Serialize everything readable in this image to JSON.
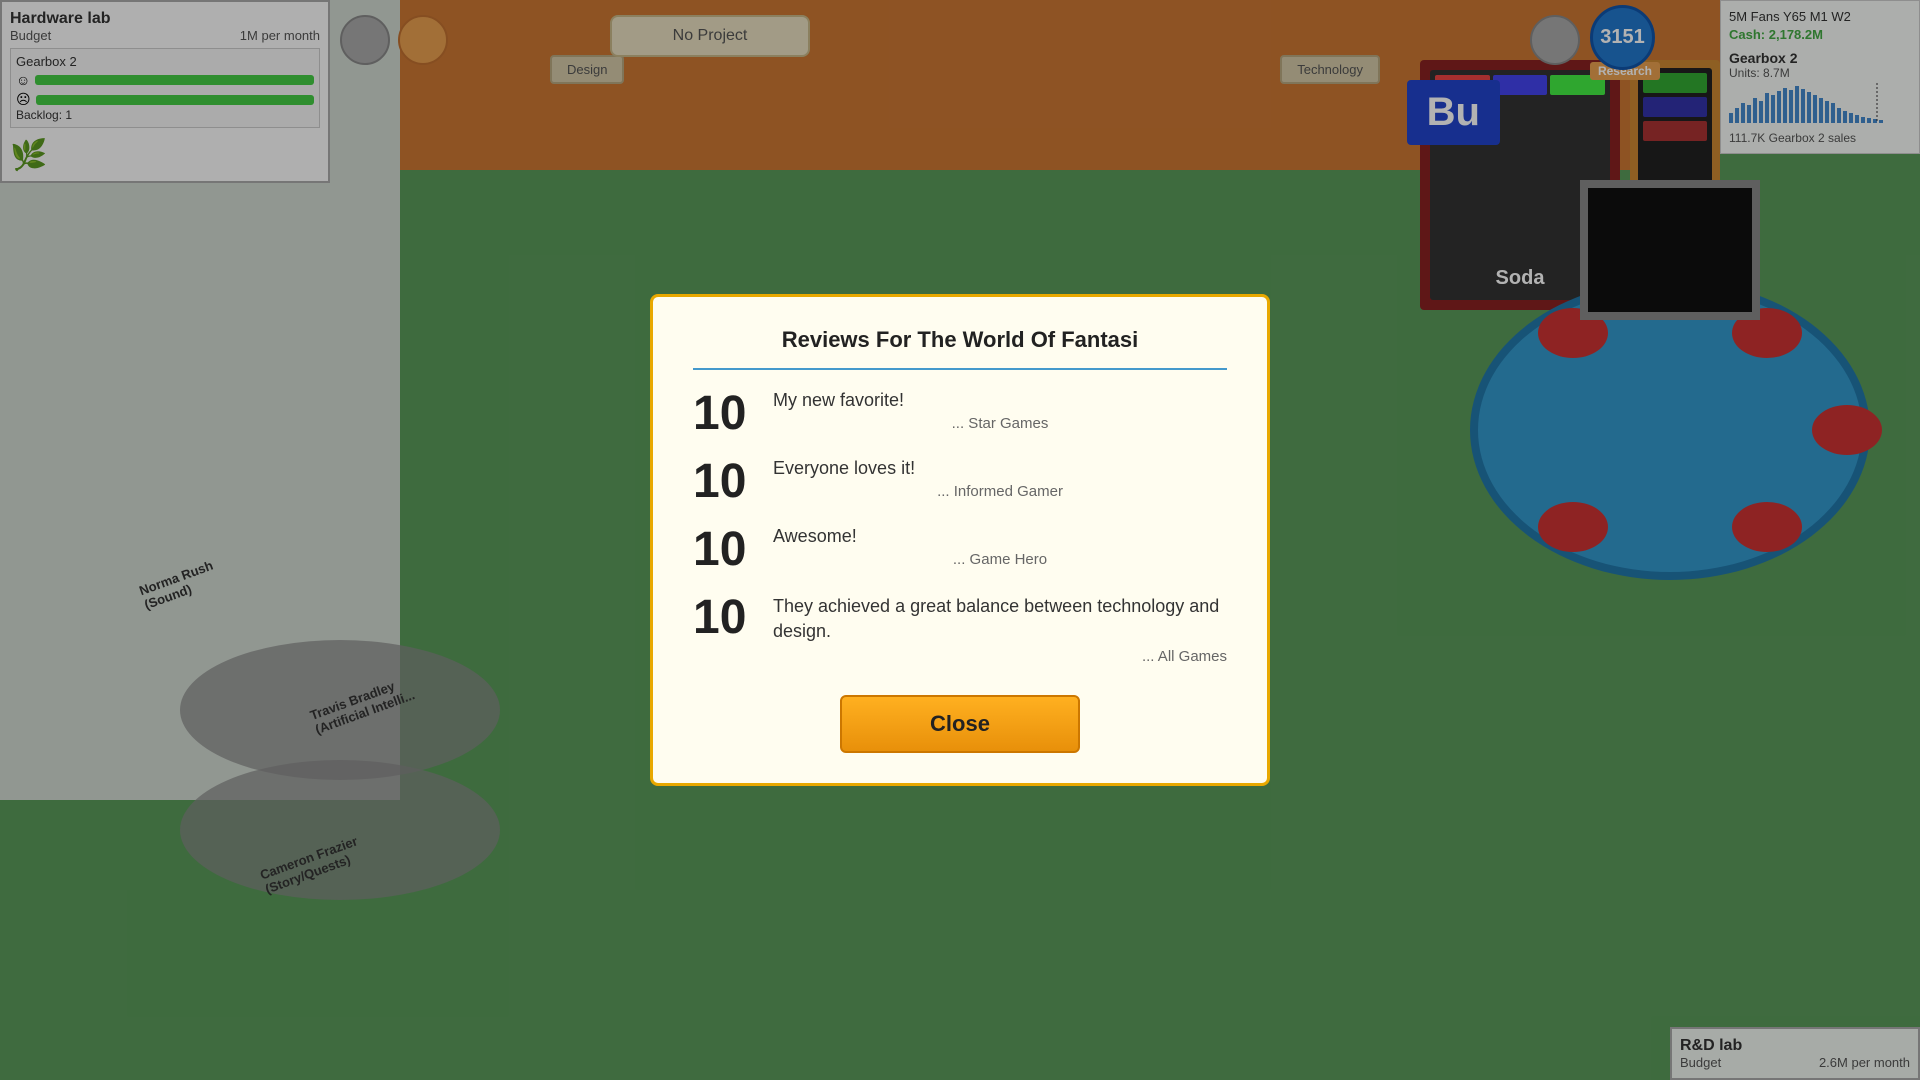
{
  "topBar": {
    "noProject": "No Project",
    "designLabel": "Design",
    "techLabel": "Technology",
    "researchValue": "3151",
    "researchLabel": "Research"
  },
  "hardwareLab": {
    "title": "Hardware lab",
    "budgetLabel": "Budget",
    "budgetValue": "1M per month",
    "gearboxTitle": "Gearbox 2",
    "backlogLabel": "Backlog:",
    "backlogValue": "1"
  },
  "statsPanel": {
    "fans": "5M Fans Y65 M1 W2",
    "cashLabel": "Cash:",
    "cashValue": "2,178.2M",
    "productTitle": "Gearbox 2",
    "unitsLabel": "Units:",
    "unitsValue": "8.7M",
    "salesValue": "111.7K",
    "salesLabel": "Gearbox 2 sales"
  },
  "rdLab": {
    "title": "R&D lab",
    "budgetLabel": "Budget",
    "budgetValue": "2.6M per month"
  },
  "modal": {
    "title": "Reviews For The World Of Fantasi",
    "reviews": [
      {
        "score": "10",
        "text": "My new favorite!",
        "source": "... Star Games"
      },
      {
        "score": "10",
        "text": "Everyone loves it!",
        "source": "... Informed Gamer"
      },
      {
        "score": "10",
        "text": "Awesome!",
        "source": "... Game Hero"
      },
      {
        "score": "10",
        "text": "They achieved a great balance between technology and design.",
        "source": "... All Games"
      }
    ],
    "closeButton": "Close"
  },
  "employees": [
    {
      "name": "Travis Bradley",
      "role": "(Artificial Intelli..."
    },
    {
      "name": "Norma Rush",
      "role": "(Sound)"
    },
    {
      "name": "Cameron Frazier",
      "role": "(Story/Quests)"
    }
  ]
}
